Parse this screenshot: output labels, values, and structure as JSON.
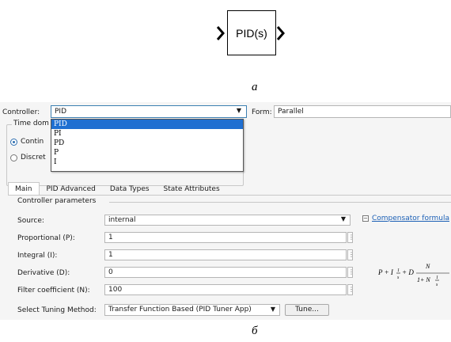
{
  "figure_a": {
    "block_label": "PID(s)",
    "caption": "а"
  },
  "figure_b": {
    "caption": "б",
    "controller": {
      "label": "Controller:",
      "value": "PID",
      "options": [
        "PID",
        "PI",
        "PD",
        "P",
        "I"
      ],
      "selected_index": 0
    },
    "form": {
      "label": "Form:",
      "value": "Parallel"
    },
    "time_domain": {
      "legend": "Time dom",
      "options": [
        {
          "label": "Contin",
          "checked": true
        },
        {
          "label": "Discret",
          "checked": false
        }
      ]
    },
    "tabs": [
      {
        "label": "Main",
        "active": true
      },
      {
        "label": "PID Advanced",
        "active": false
      },
      {
        "label": "Data Types",
        "active": false
      },
      {
        "label": "State Attributes",
        "active": false
      }
    ],
    "params_legend": "Controller parameters",
    "params": {
      "source_label": "Source:",
      "source_value": "internal",
      "proportional_label": "Proportional (P):",
      "proportional_value": "1",
      "integral_label": "Integral (I):",
      "integral_value": "1",
      "derivative_label": "Derivative (D):",
      "derivative_value": "0",
      "filter_label": "Filter coefficient (N):",
      "filter_value": "100"
    },
    "compensator_link": "Compensator formula",
    "tuning": {
      "label": "Select Tuning Method:",
      "value": "Transfer Function Based (PID Tuner App)",
      "button": "Tune..."
    },
    "colors": {
      "selection": "#1f6fd1",
      "link": "#1b5fb5",
      "dialog_bg": "#f5f5f5"
    }
  }
}
